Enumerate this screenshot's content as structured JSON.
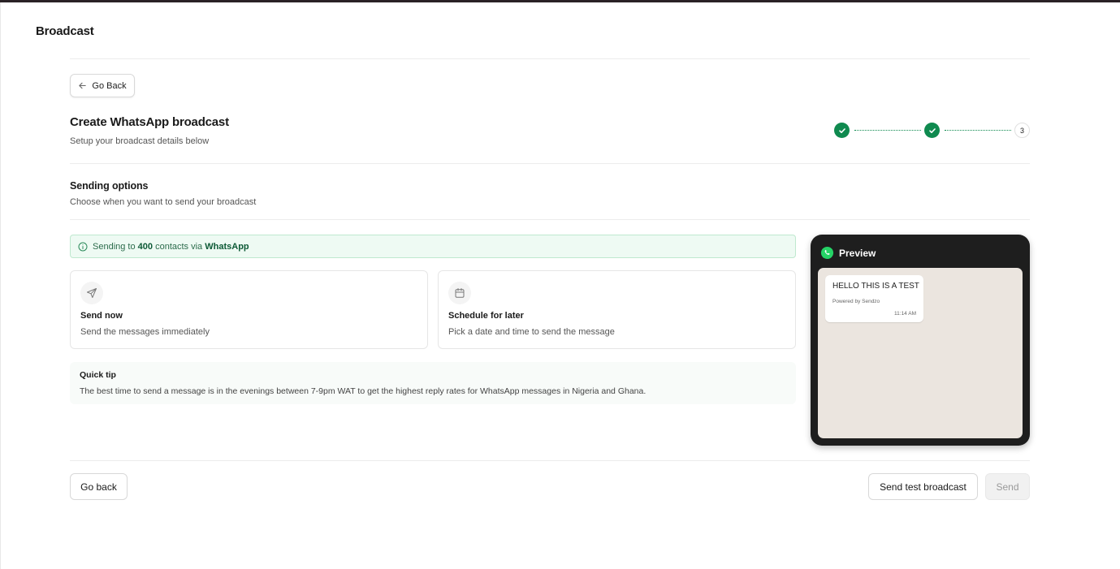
{
  "app": {
    "title": "Broadcast"
  },
  "header": {
    "back_label": "Go Back",
    "title": "Create WhatsApp broadcast",
    "subtitle": "Setup your broadcast details below"
  },
  "stepper": {
    "steps": [
      {
        "state": "complete",
        "label": ""
      },
      {
        "state": "complete",
        "label": ""
      },
      {
        "state": "current",
        "label": "3"
      }
    ]
  },
  "sending_options": {
    "title": "Sending options",
    "subtitle": "Choose when you want to send your broadcast"
  },
  "info_banner": {
    "prefix": "Sending to",
    "count": "400",
    "middle": "contacts via",
    "channel": "WhatsApp",
    "color_bg": "#eefaf3"
  },
  "options": [
    {
      "icon": "send-icon",
      "title": "Send now",
      "description": "Send the messages immediately"
    },
    {
      "icon": "calendar-icon",
      "title": "Schedule for later",
      "description": "Pick a date and time to send the message"
    }
  ],
  "tip": {
    "title": "Quick tip",
    "body": "The best time to send a message is in the evenings between 7-9pm WAT to get the highest reply rates for WhatsApp messages in Nigeria and Ghana."
  },
  "preview": {
    "title": "Preview",
    "message": "HELLO THIS IS A TEST",
    "powered_by": "Powered by Sendzo",
    "time": "11:14 AM"
  },
  "footer": {
    "back_label": "Go back",
    "test_label": "Send test broadcast",
    "send_label": "Send"
  },
  "colors": {
    "accent": "#0f8a4f",
    "preview_frame": "#1e1e1e",
    "chat_bg": "#ebe5df"
  }
}
